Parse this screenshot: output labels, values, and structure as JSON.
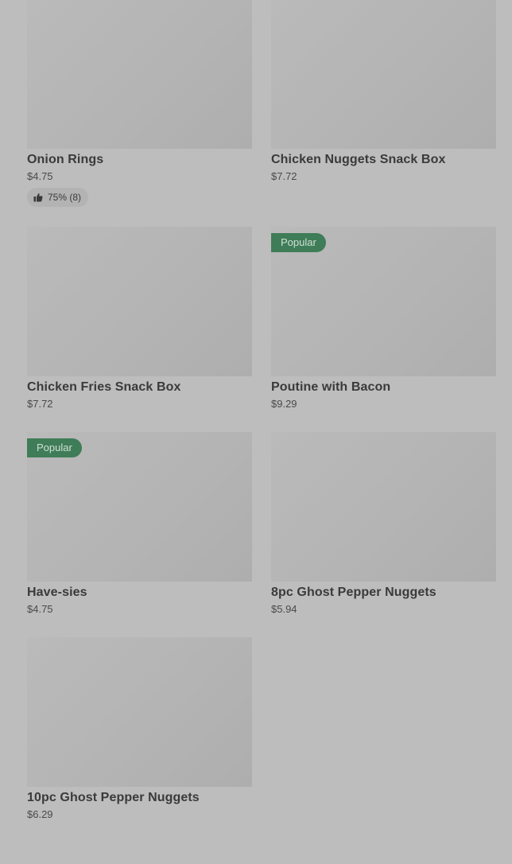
{
  "items": [
    {
      "name": "Onion Rings",
      "price": "$4.75",
      "rating": "75% (8)",
      "badge": ""
    },
    {
      "name": "Chicken Nuggets Snack Box",
      "price": "$7.72",
      "rating": "",
      "badge": ""
    },
    {
      "name": "Chicken Fries Snack Box",
      "price": "$7.72",
      "rating": "",
      "badge": ""
    },
    {
      "name": "Poutine with Bacon",
      "price": "$9.29",
      "rating": "",
      "badge": "Popular"
    },
    {
      "name": "Have-sies",
      "price": "$4.75",
      "rating": "",
      "badge": "Popular"
    },
    {
      "name": "8pc Ghost Pepper Nuggets",
      "price": "$5.94",
      "rating": "",
      "badge": ""
    },
    {
      "name": "10pc Ghost Pepper Nuggets",
      "price": "$6.29",
      "rating": "",
      "badge": ""
    }
  ],
  "colors": {
    "background": "#bdbdbd",
    "badge": "#3f7c58",
    "thumbnail": "#b7b7b7"
  },
  "icons": {
    "rating": "thumbs-up-icon"
  }
}
